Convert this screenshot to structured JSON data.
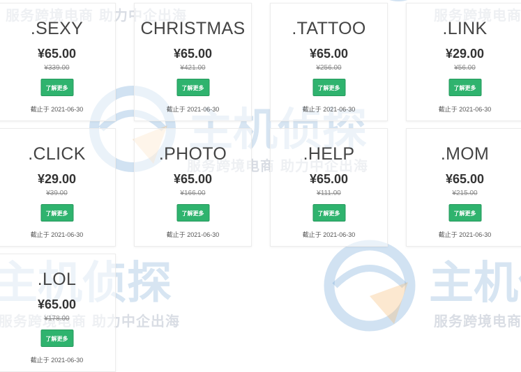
{
  "watermark": {
    "tagline": "服务跨境电商 助力中企出海",
    "logo_text": "主机侦探"
  },
  "cards": [
    {
      "name": ".SEXY",
      "price": "¥65.00",
      "original_price": "¥339.00",
      "button_label": "了解更多",
      "deadline_label": "截止于 2021-06-30"
    },
    {
      "name": "CHRISTMAS",
      "price": "¥65.00",
      "original_price": "¥421.00",
      "button_label": "了解更多",
      "deadline_label": "截止于 2021-06-30"
    },
    {
      "name": ".TATTOO",
      "price": "¥65.00",
      "original_price": "¥256.00",
      "button_label": "了解更多",
      "deadline_label": "截止于 2021-06-30"
    },
    {
      "name": ".LINK",
      "price": "¥29.00",
      "original_price": "¥56.00",
      "button_label": "了解更多",
      "deadline_label": "截止于 2021-06-30"
    },
    {
      "name": ".CLICK",
      "price": "¥29.00",
      "original_price": "¥39.00",
      "button_label": "了解更多",
      "deadline_label": "截止于 2021-06-30"
    },
    {
      "name": ".PHOTO",
      "price": "¥65.00",
      "original_price": "¥166.00",
      "button_label": "了解更多",
      "deadline_label": "截止于 2021-06-30"
    },
    {
      "name": ".HELP",
      "price": "¥65.00",
      "original_price": "¥111.00",
      "button_label": "了解更多",
      "deadline_label": "截止于 2021-06-30"
    },
    {
      "name": ".MOM",
      "price": "¥65.00",
      "original_price": "¥215.00",
      "button_label": "了解更多",
      "deadline_label": "截止于 2021-06-30"
    },
    {
      "name": ".LOL",
      "price": "¥65.00",
      "original_price": "¥178.00",
      "button_label": "了解更多",
      "deadline_label": "截止于 2021-06-30"
    }
  ]
}
